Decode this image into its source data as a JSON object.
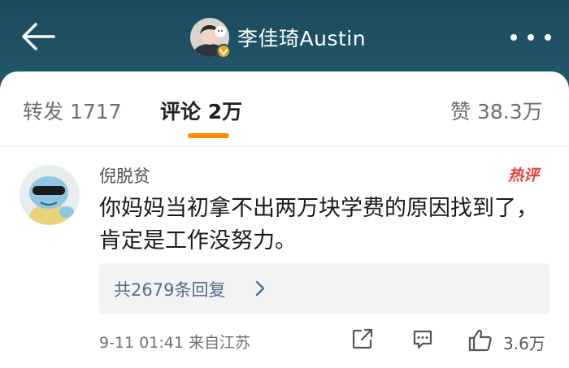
{
  "header": {
    "author_name": "李佳琦Austin"
  },
  "tabs": {
    "repost": "转发 1717",
    "comments": "评论 2万",
    "likes": "赞 38.3万"
  },
  "comment": {
    "username": "倪脱贫",
    "hot_badge": "热评",
    "text": "你妈妈当初拿不出两万块学费的原因找到了，肯定是工作没努力。",
    "replies_label": "共2679条回复",
    "meta": "9-11 01:41  来自江苏",
    "like_count": "3.6万"
  },
  "colors": {
    "header_bg": "#1f5368",
    "tab_indicator": "#ff8a00",
    "hot_badge": "#e8403a",
    "reply_link": "#4e6f8f",
    "verified_badge": "#f3a21a"
  },
  "icons": [
    "back-arrow-icon",
    "verified-badge-icon",
    "more-dots-icon",
    "chevron-right-icon",
    "share-icon",
    "comment-icon",
    "thumbs-up-icon"
  ]
}
